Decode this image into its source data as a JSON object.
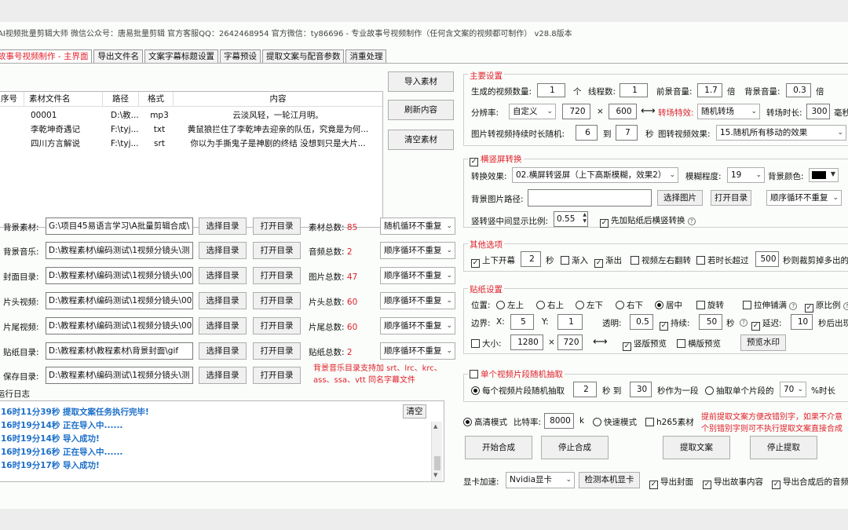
{
  "window": {
    "title": "AI视频批量剪辑大师   微信公众号：唐易批量剪辑   官方客服QQ：2642468954   官方微信：ty86696  -  专业故事号视频制作（任何含文案的视频都可制作）   v28.8版本"
  },
  "tabs": [
    "故事号视频制作 - 主界面",
    "导出文件名",
    "文案字幕标题设置",
    "字幕预设",
    "提取文案与配音参数",
    "消重处理"
  ],
  "grid": {
    "headers": [
      "序号",
      "素材文件名",
      "路径",
      "格式",
      "内容"
    ],
    "rows": [
      [
        "",
        "00001",
        "D:\\教...",
        "mp3",
        "云淡风轻，一轮江月明。"
      ],
      [
        "",
        "李乾坤奇遇记",
        "F:\\tyj...",
        "txt",
        "黄鼠狼拦住了李乾坤去迎亲的队伍，究竟是为何..."
      ],
      [
        "",
        "四川方言解说",
        "F:\\tyj...",
        "srt",
        "你以为手撕鬼子是神剧的终结 没想到只是大片..."
      ]
    ]
  },
  "side_buttons": {
    "import": "导入素材",
    "refresh": "刷新内容",
    "clear": "清空素材"
  },
  "dirs": [
    {
      "label": "背景素材:",
      "path": "G:\\项目45易语言学习\\A批量剪辑合成\\",
      "count_label": "素材总数:",
      "count": "85",
      "mode": "随机循环不重复"
    },
    {
      "label": "背景音乐:",
      "path": "D:\\教程素材\\编码测试\\1视频分镜头\\测",
      "count_label": "音频总数:",
      "count": "2",
      "mode": "顺序循环不重复"
    },
    {
      "label": "封面目录:",
      "path": "D:\\教程素材\\编码测试\\1视频分镜头\\00",
      "count_label": "图片总数:",
      "count": "47",
      "mode": "顺序循环不重复"
    },
    {
      "label": "片头视频:",
      "path": "D:\\教程素材\\编码测试\\1视频分镜头\\00",
      "count_label": "片头总数:",
      "count": "60",
      "mode": "顺序循环不重复"
    },
    {
      "label": "片尾视频:",
      "path": "D:\\教程素材\\编码测试\\1视频分镜头\\00",
      "count_label": "片尾总数:",
      "count": "60",
      "mode": "顺序循环不重复"
    },
    {
      "label": "贴纸目录:",
      "path": "D:\\教程素材\\教程素材\\背景封面\\gif",
      "count_label": "贴纸总数:",
      "count": "2",
      "mode": "顺序循环不重复"
    },
    {
      "label": "保存目录:",
      "path": "D:\\教程素材\\编码测试\\1视频分镜头\\测",
      "count_label": "",
      "count": "",
      "mode": ""
    }
  ],
  "dir_buttons": {
    "select": "选择目录",
    "open": "打开目录"
  },
  "bgm_note": "背景音乐目录支持加 srt、lrc、krc、ass、ssa、vtt 同名字幕文件",
  "log": {
    "title": "运行日志",
    "clear": "清空",
    "lines": [
      "16时11分39秒  提取文案任务执行完毕!",
      "16时19分14秒  正在导入中......",
      "16时19分14秒  导入成功!",
      "16时19分16秒  正在导入中......",
      "16时19分17秒  导入成功!"
    ]
  },
  "main_settings": {
    "title": "主要设置",
    "count_label": "生成的视频数量:",
    "count": "1",
    "count_unit": "个",
    "threads_label": "线程数:",
    "threads": "1",
    "fg_vol_label": "前景音量:",
    "fg_vol": "1.7",
    "fg_vol_unit": "倍",
    "bg_vol_label": "背景音量:",
    "bg_vol": "0.3",
    "bg_vol_unit": "倍",
    "res_label": "分辨率:",
    "res_mode": "自定义",
    "width": "720",
    "x": "×",
    "height": "600",
    "swap": "⟷",
    "transition_label": "转场特效:",
    "transition": "随机转场",
    "trans_dur_label": "转场时长:",
    "trans_dur": "300",
    "trans_dur_unit": "毫秒",
    "img_dur_label": "图片转视频持续时长随机:",
    "img_min": "6",
    "img_to": "到",
    "img_max": "7",
    "img_unit": "秒",
    "img_effect_label": "图转视频效果:",
    "img_effect": "15.随机所有移动的效果"
  },
  "hv": {
    "title": "横竖屏转换",
    "effect_label": "转换效果:",
    "effect": "02.横屏转竖屏（上下高斯模糊，效果2）",
    "blur_label": "模糊程度:",
    "blur": "19",
    "bgcolor_label": "背景颜色:",
    "bgimg_label": "背景图片路径:",
    "bgimg": "",
    "select_img": "选择图片",
    "open_dir": "打开目录",
    "mode": "顺序循环不重复",
    "ratio_label": "竖转竖中间显示比例:",
    "ratio": "0.55",
    "sticker_first": "先加贴纸后横竖转换"
  },
  "other": {
    "title": "其他选项",
    "fade_open": "上下开幕",
    "fade_open_val": "2",
    "sec": "秒",
    "fade_in": "渐入",
    "fade_out": "渐出",
    "flip": "视频左右翻转",
    "trim_label": "若时长超过",
    "trim": "500",
    "trim_suffix": "秒则裁剪掉多出的"
  },
  "sticker": {
    "title": "贴纸设置",
    "pos_label": "位置:",
    "positions": [
      "左上",
      "右上",
      "左下",
      "右下",
      "居中"
    ],
    "rotate": "旋转",
    "stretch": "拉伸铺满",
    "ratio": "原比例",
    "margin_label": "边界:",
    "x_label": "X:",
    "x": "5",
    "y_label": "Y:",
    "y": "1",
    "alpha_label": "透明:",
    "alpha": "0.5",
    "dur_label": "持续:",
    "dur": "50",
    "dur_unit": "秒",
    "delay_label": "延迟:",
    "delay": "10",
    "delay_suffix": "秒后出现",
    "size_label": "大小:",
    "w": "1280",
    "h": "720",
    "swap": "⟷",
    "v_preview": "竖版预览",
    "h_preview": "横版预览",
    "preview_btn": "预览水印"
  },
  "clip": {
    "title": "单个视频片段随机抽取",
    "mode1": "每个视频片段随机抽取",
    "a": "2",
    "sec_to": "秒 到",
    "b": "30",
    "seg": "秒作为一段",
    "mode2": "抽取单个片段的",
    "pct": "70",
    "pct_suffix": "%时长"
  },
  "render": {
    "hq": "高清模式",
    "bitrate_label": "比特率:",
    "bitrate": "8000",
    "k": "k",
    "fast": "快速模式",
    "h265": "h265素材",
    "note1": "提前提取文案方便改错别字，如果不介意",
    "note2": "个别错别字则可不执行提取文案直接合成",
    "start": "开始合成",
    "stop": "停止合成",
    "extract": "提取文案",
    "stop_extract": "停止提取"
  },
  "gpu": {
    "label": "显卡加速:",
    "value": "Nvidia显卡",
    "detect": "检测本机显卡",
    "export_cover": "导出封面",
    "export_story": "导出故事内容",
    "export_audio": "导出合成后的音频"
  }
}
